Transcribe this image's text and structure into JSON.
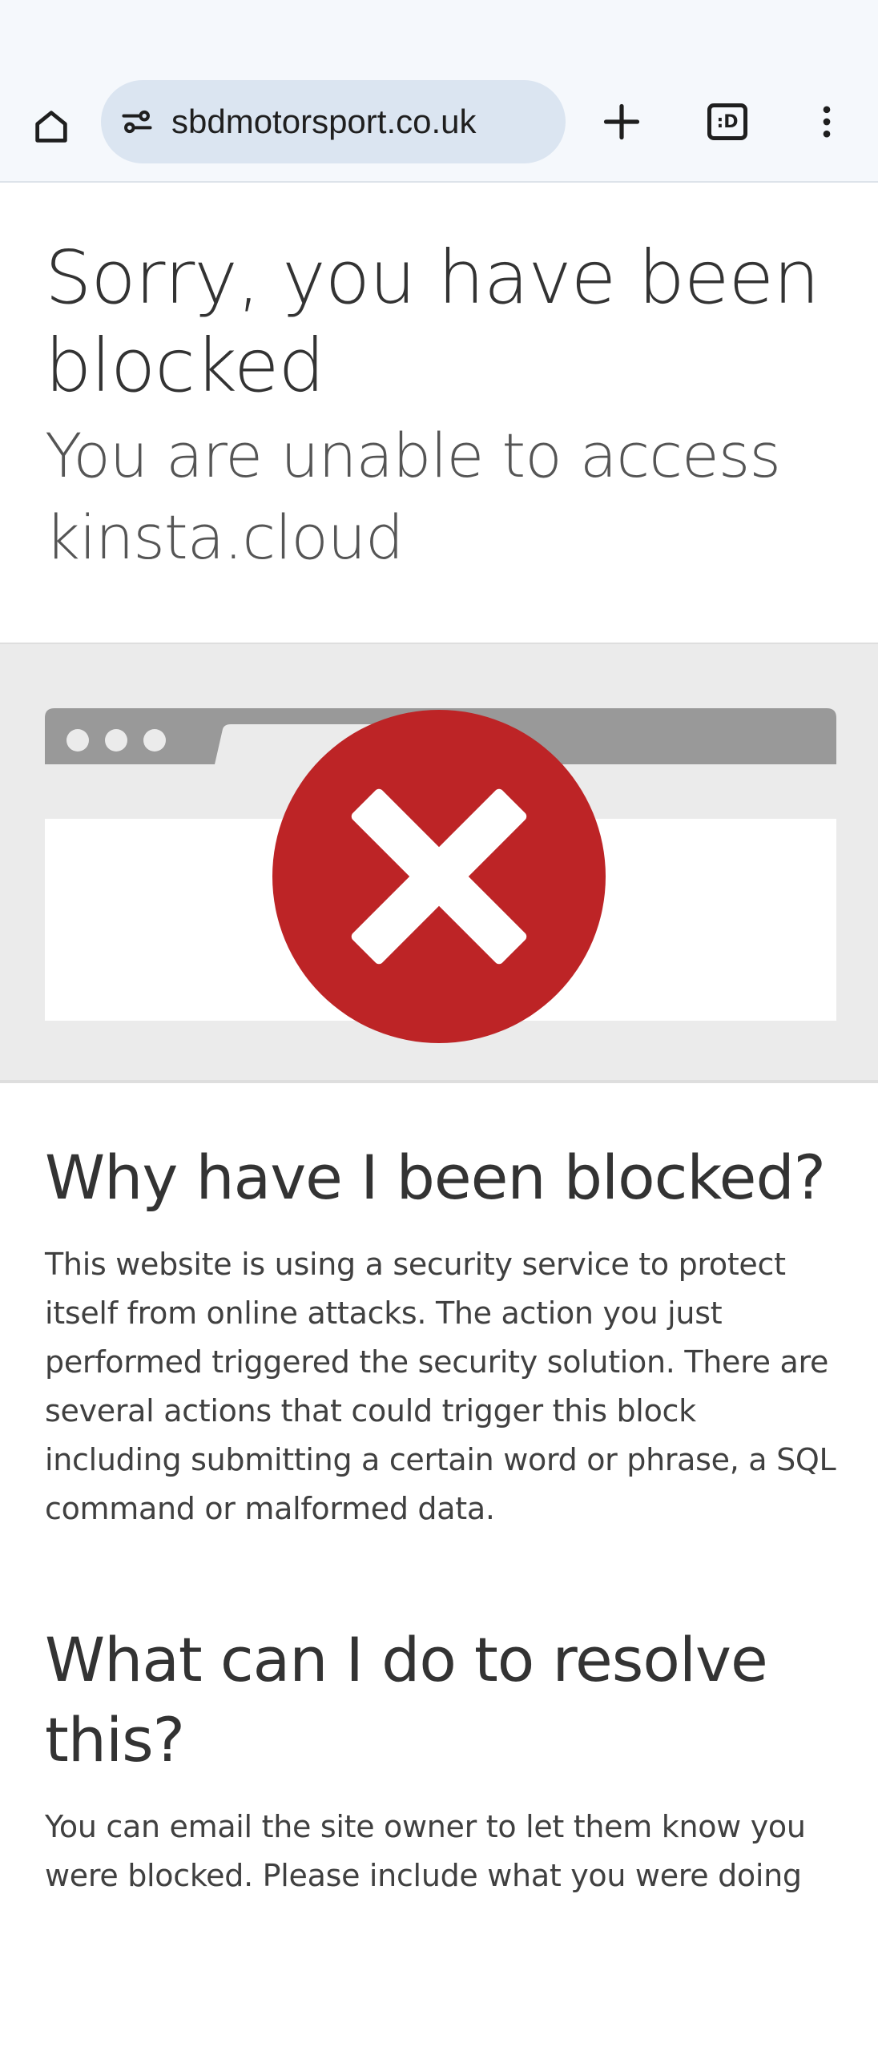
{
  "browser": {
    "url": "sbdmotorsport.co.uk",
    "tab_count_label": ":D",
    "icons": [
      "home-icon",
      "site-info-icon",
      "plus-icon",
      "tab-switcher-icon",
      "more-vert-icon"
    ]
  },
  "page": {
    "title": "Sorry, you have been blocked",
    "subtitle": "You are unable to access kinsta.cloud",
    "sections": [
      {
        "heading": "Why have I been blocked?",
        "body": "This website is using a security service to protect itself from online attacks. The action you just performed triggered the security solution. There are several actions that could trigger this block including submitting a certain word or phrase, a SQL command or malformed data."
      },
      {
        "heading": "What can I do to resolve this?",
        "body": "You can email the site owner to let them know you were blocked. Please include what you were doing"
      }
    ]
  },
  "colors": {
    "chrome_background": "#f5f8fc",
    "omnibox_background": "#dbe5f1",
    "block_red": "#bd2426",
    "band_background": "#ebebeb",
    "browser_bar_gray": "#999999"
  }
}
